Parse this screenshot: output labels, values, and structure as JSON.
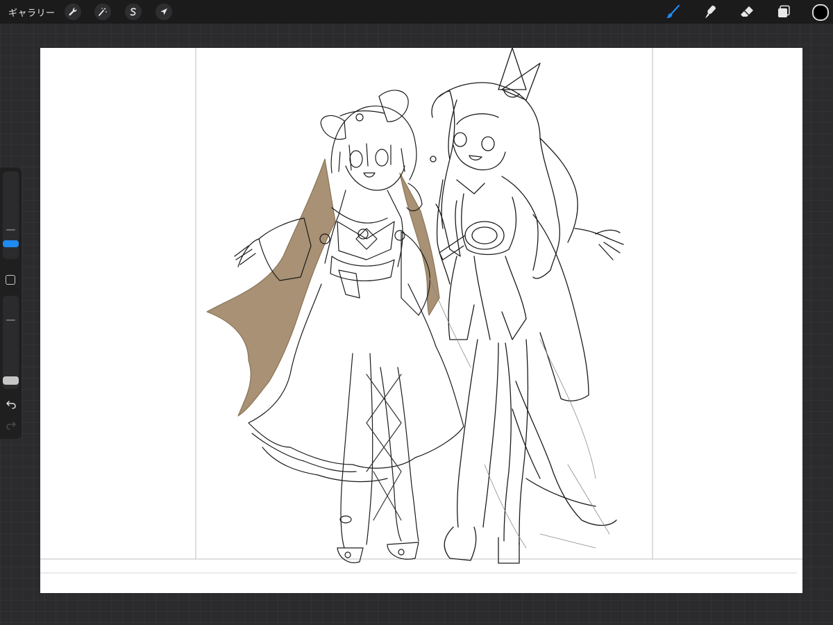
{
  "topbar": {
    "gallery_label": "ギャラリー",
    "left_tools": [
      {
        "name": "actions",
        "icon": "wrench-icon"
      },
      {
        "name": "adjustments",
        "icon": "magic-wand-icon"
      },
      {
        "name": "selection",
        "icon": "selection-s-icon"
      },
      {
        "name": "transform",
        "icon": "arrow-cursor-icon"
      }
    ],
    "right_tools": [
      {
        "name": "brush",
        "icon": "brush-icon",
        "active": true
      },
      {
        "name": "smudge",
        "icon": "smudge-finger-icon",
        "active": false
      },
      {
        "name": "eraser",
        "icon": "eraser-icon",
        "active": false
      },
      {
        "name": "layers",
        "icon": "layers-icon",
        "active": false
      }
    ],
    "current_color": "#000000"
  },
  "sidebar": {
    "size_slider_level": 0.15,
    "opacity_slider_level": 0.05,
    "undo_icon": "undo-arrow-icon",
    "redo_icon": "redo-arrow-icon",
    "modify_icon": "square-modify-icon"
  },
  "colors": {
    "accent": "#1f8af2",
    "hair_fill": "#a89174",
    "line": "#1a1a1a"
  }
}
